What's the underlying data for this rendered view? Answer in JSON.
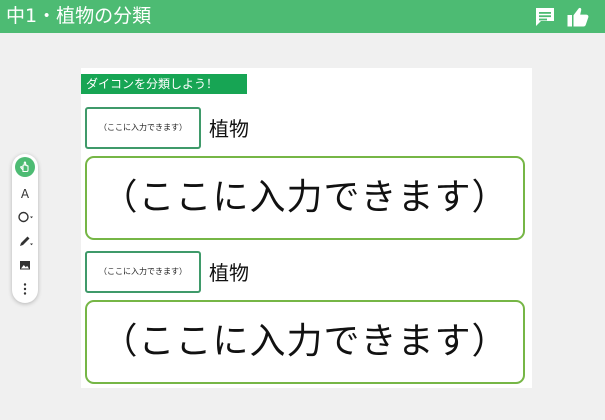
{
  "header": {
    "title": "中1・植物の分類",
    "icons": [
      "comment-icon",
      "thumbs-up-icon"
    ]
  },
  "toolbar": {
    "tools": [
      "hand-icon",
      "text-icon",
      "shape-icon",
      "pen-icon",
      "image-icon",
      "more-icon"
    ],
    "text_tool_label": "A",
    "accent": "#4dbb73"
  },
  "worksheet": {
    "banner": "ダイコンを分類しよう！",
    "groups": [
      {
        "small_placeholder": "（ここに入力できます）",
        "label": "植物",
        "big_placeholder": "（ここに入力できます）"
      },
      {
        "small_placeholder": "（ここに入力できます）",
        "label": "植物",
        "big_placeholder": "（ここに入力できます）"
      }
    ]
  },
  "colors": {
    "header": "#4dbb73",
    "banner": "#17a554",
    "small_border": "#3f9a6a",
    "big_border": "#76b646"
  }
}
